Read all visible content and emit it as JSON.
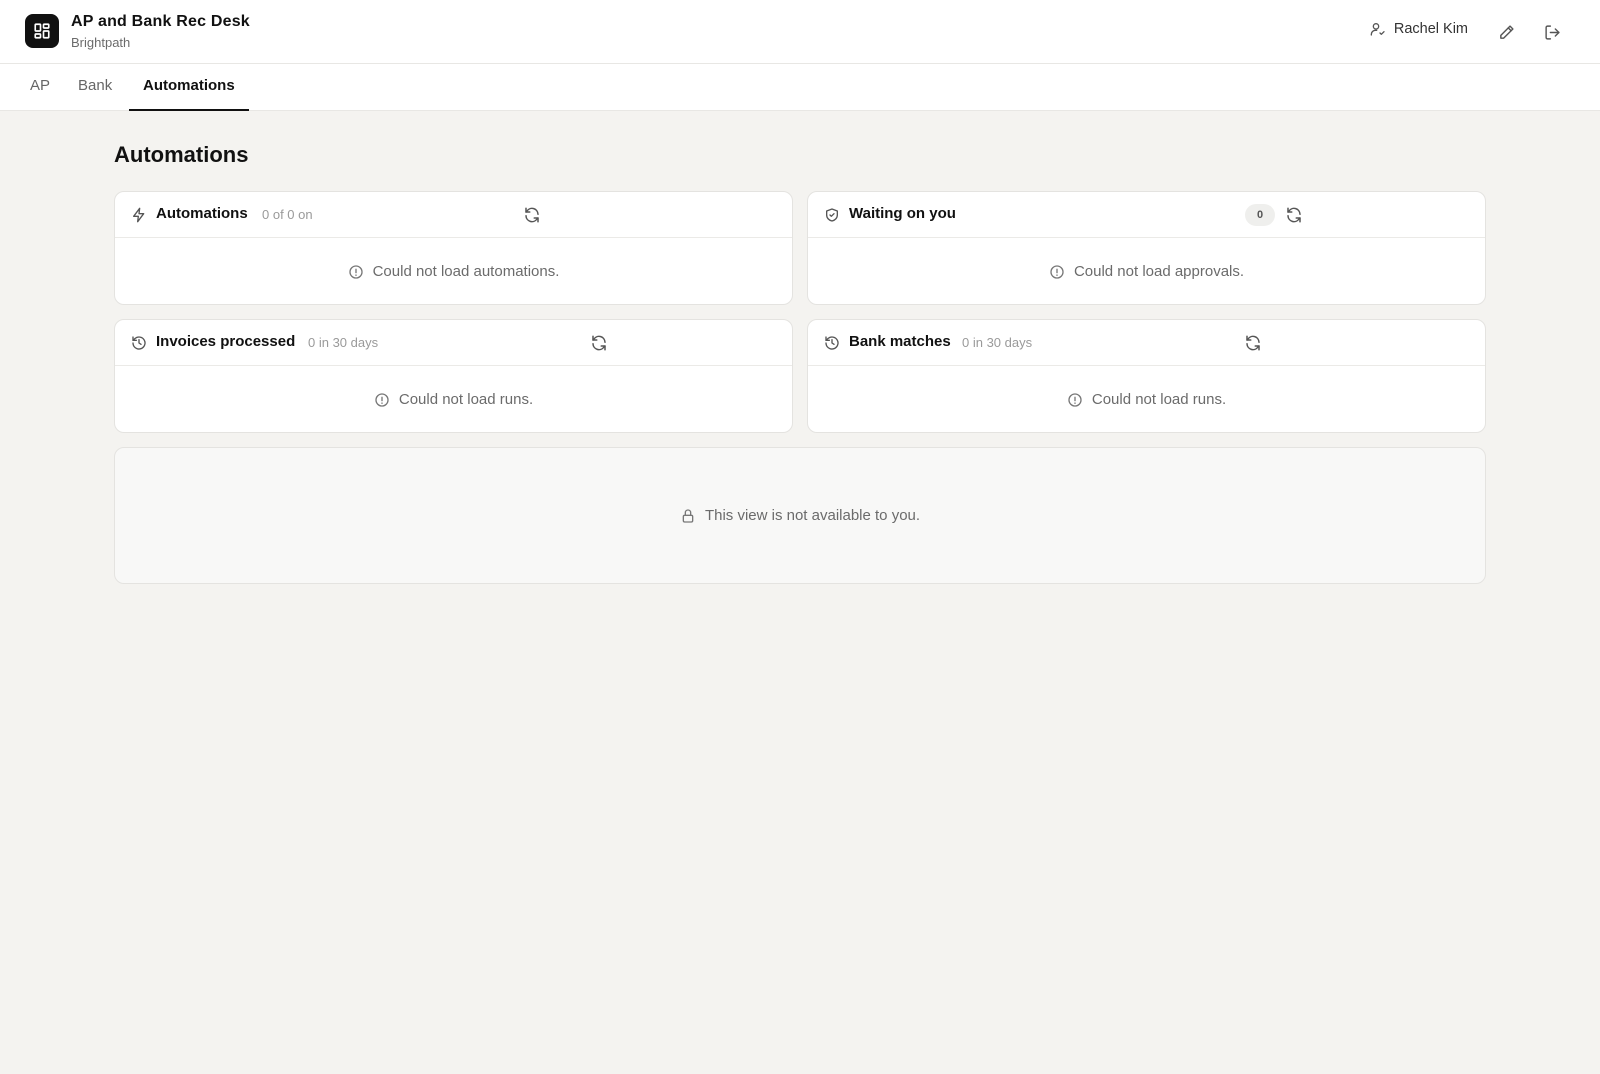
{
  "header": {
    "app_title": "AP and Bank Rec Desk",
    "org_name": "Brightpath",
    "user_name": "Rachel Kim"
  },
  "tabs": [
    {
      "label": "AP",
      "active": false
    },
    {
      "label": "Bank",
      "active": false
    },
    {
      "label": "Automations",
      "active": true
    }
  ],
  "page": {
    "title": "Automations"
  },
  "cards": {
    "automations": {
      "title": "Automations",
      "subtitle": "0 of 0 on",
      "message": "Could not load automations."
    },
    "waiting": {
      "title": "Waiting on you",
      "badge": "0",
      "message": "Could not load approvals."
    },
    "invoices": {
      "title": "Invoices processed",
      "subtitle": "0 in 30 days",
      "message": "Could not load runs."
    },
    "bank_matches": {
      "title": "Bank matches",
      "subtitle": "0 in 30 days",
      "message": "Could not load runs."
    }
  },
  "locked_view": {
    "message": "This view is not available to you."
  },
  "icons": {
    "logo": "dashboard-grid-icon",
    "user": "user-check-icon",
    "edit": "pencil-icon",
    "logout": "logout-icon",
    "automations": "lightning-icon",
    "waiting": "shield-check-icon",
    "history": "history-icon",
    "refresh": "refresh-icon",
    "error": "alert-circle-icon",
    "lock": "lock-icon"
  },
  "colors": {
    "accent": "#111111",
    "background": "#f4f3f0",
    "muted_text": "#6b6b6b"
  }
}
